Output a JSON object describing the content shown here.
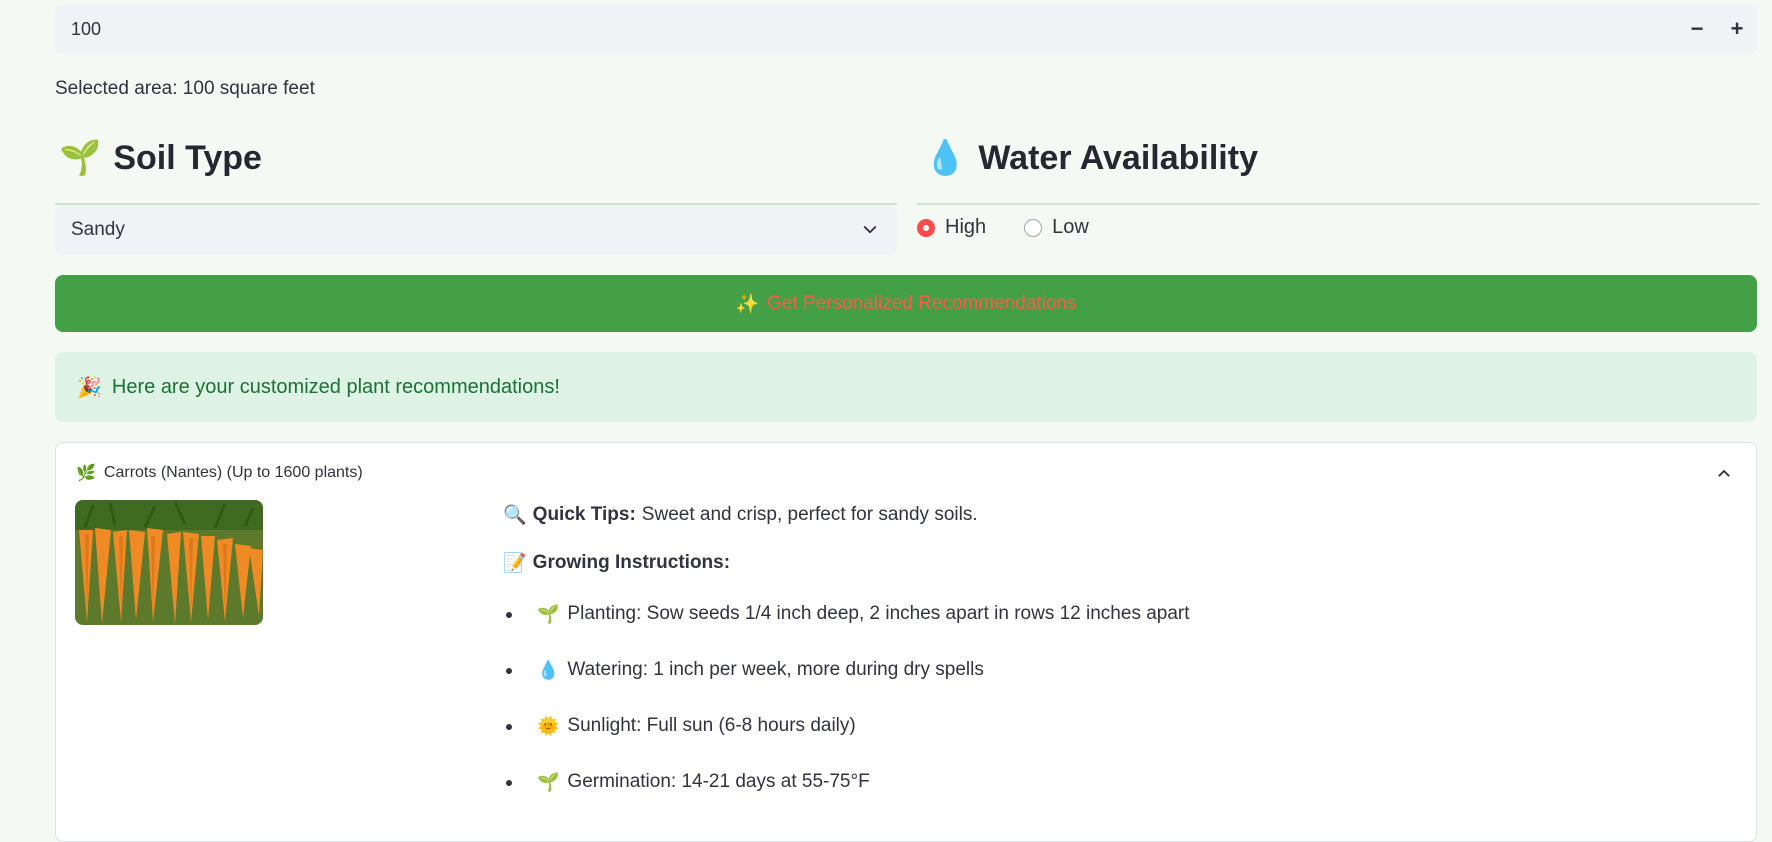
{
  "area_input": {
    "value": "100",
    "minus_label": "−",
    "plus_label": "+"
  },
  "area_text": "Selected area: 100 square feet",
  "soil": {
    "icon": "seedling",
    "emoji": "🌱",
    "title": "Soil Type",
    "selected": "Sandy"
  },
  "water": {
    "icon": "droplet",
    "emoji": "💧",
    "title": "Water Availability",
    "options": [
      {
        "label": "High",
        "checked": true
      },
      {
        "label": "Low",
        "checked": false
      }
    ]
  },
  "recommend_button": {
    "icon": "sparkles",
    "emoji": "✨",
    "label": "Get Personalized Recommendations",
    "bg_color": "#43a047",
    "text_color": "#ff5a45"
  },
  "success": {
    "icon": "party-popper",
    "emoji": "🎉",
    "text": "Here are your customized plant recommendations!"
  },
  "plant": {
    "icon": "herb",
    "emoji": "🌿",
    "title": "Carrots (Nantes) (Up to 1600 plants)",
    "image_alt": "carrots",
    "quick_tips_emoji": "🔍",
    "quick_tips_label": "Quick Tips:",
    "quick_tips_text": "Sweet and crisp, perfect for sandy soils.",
    "instructions_emoji": "📝",
    "instructions_label": "Growing Instructions:",
    "instructions": [
      {
        "emoji": "🌱",
        "text": "Planting: Sow seeds 1/4 inch deep, 2 inches apart in rows 12 inches apart"
      },
      {
        "emoji": "💧",
        "text": "Watering: 1 inch per week, more during dry spells"
      },
      {
        "emoji": "🌞",
        "text": "Sunlight: Full sun (6-8 hours daily)"
      },
      {
        "emoji": "🌱",
        "text": "Germination: 14-21 days at 55-75°F"
      }
    ]
  }
}
